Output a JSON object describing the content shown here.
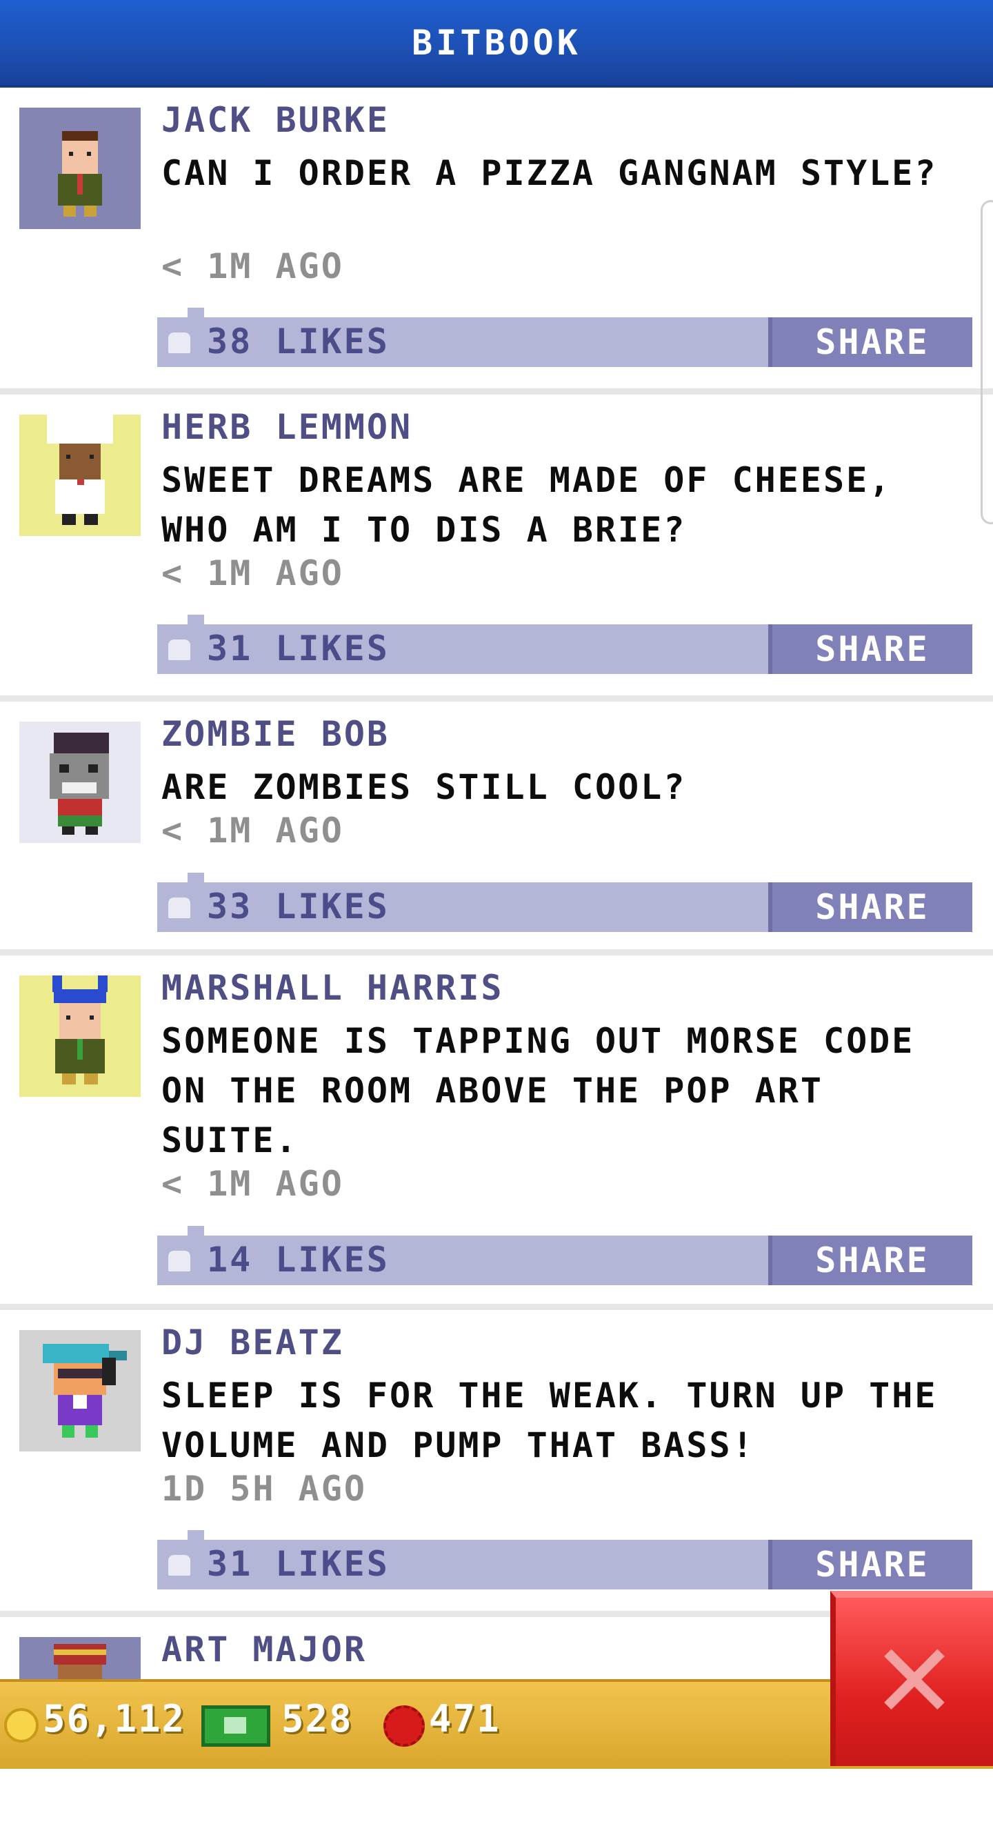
{
  "header": {
    "title": "BITBOOK"
  },
  "posts": [
    {
      "author": "JACK BURKE",
      "message": "CAN I ORDER A PIZZA GANGNAM STYLE?",
      "time": "< 1M AGO",
      "likes": "38 LIKES",
      "share": "SHARE",
      "avatar_bg": "#8585b3"
    },
    {
      "author": "HERB LEMMON",
      "message": "SWEET DREAMS ARE MADE OF CHEESE, WHO AM I TO DIS A BRIE?",
      "time": "< 1M AGO",
      "likes": "31 LIKES",
      "share": "SHARE",
      "avatar_bg": "#ecec8f"
    },
    {
      "author": "ZOMBIE BOB",
      "message": "ARE ZOMBIES STILL COOL?",
      "time": "< 1M AGO",
      "likes": "33 LIKES",
      "share": "SHARE",
      "avatar_bg": "#e8e8f2"
    },
    {
      "author": "MARSHALL HARRIS",
      "message": "SOMEONE IS TAPPING OUT MORSE CODE ON THE ROOM ABOVE THE POP ART SUITE.",
      "time": "< 1M AGO",
      "likes": "14 LIKES",
      "share": "SHARE",
      "avatar_bg": "#ecec8f"
    },
    {
      "author": "DJ BEATZ",
      "message": "SLEEP IS FOR THE WEAK. TURN UP THE VOLUME AND PUMP THAT BASS!",
      "time": "1D 5H AGO",
      "likes": "31 LIKES",
      "share": "SHARE",
      "avatar_bg": "#d3d3d3"
    },
    {
      "author": "ART MAJOR",
      "avatar_bg": "#8585b3"
    }
  ],
  "bottom_bar": {
    "coins": "56,112",
    "bux": "528",
    "gems": "471"
  },
  "icons": {
    "like": "like-hand-icon",
    "close": "close-icon",
    "coin": "coin-icon",
    "bux": "bux-icon",
    "gem": "gem-icon"
  },
  "colors": {
    "header": "#1d4fb2",
    "like_bar": "#b4b6d8",
    "share": "#7f81b8",
    "author": "#4f4f86",
    "close": "#e02020"
  }
}
